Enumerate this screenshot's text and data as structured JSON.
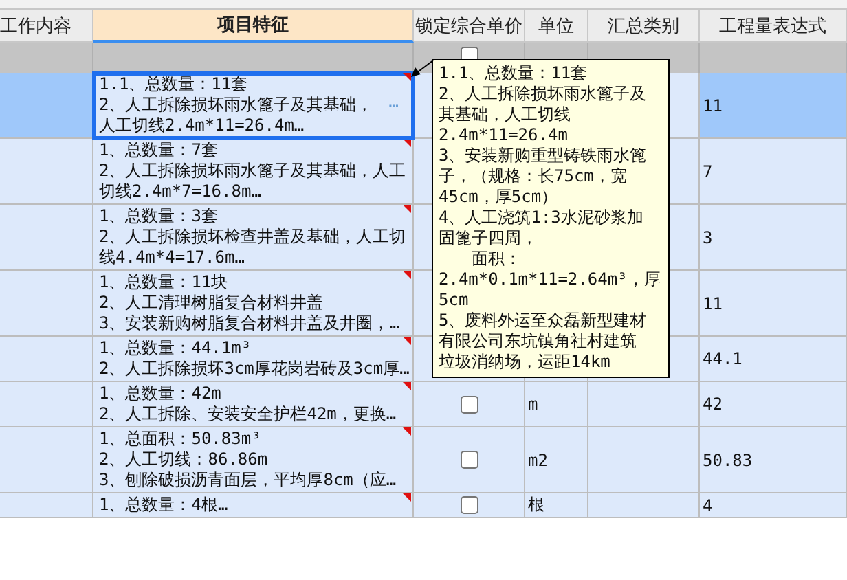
{
  "columns": [
    {
      "label": "工作内容",
      "kind": "plain"
    },
    {
      "label": "项目特征",
      "kind": "active"
    },
    {
      "label": "锁定综合单价",
      "kind": "plain"
    },
    {
      "label": "单位",
      "kind": "plain"
    },
    {
      "label": "汇总类别",
      "kind": "plain"
    },
    {
      "label": "工程量表达式",
      "kind": "plain"
    }
  ],
  "filter_row": {
    "locked": false
  },
  "rows": [
    {
      "selected": true,
      "features": [
        "1.1、总数量：11套",
        "2、人工拆除损坏雨水篦子及其基础，",
        "人工切线2.4m*11=26.4m…"
      ],
      "expression": "11",
      "ellipsis": "…"
    },
    {
      "selected": false,
      "features": [
        "1、总数量：7套",
        "2、人工拆除损坏雨水篦子及其基础，人工",
        "切线2.4m*7=16.8m…"
      ],
      "expression": "7"
    },
    {
      "selected": false,
      "features": [
        "1、总数量：3套",
        "2、人工拆除损坏检查井盖及基础，人工切",
        "线4.4m*4=17.6m…"
      ],
      "expression": "3"
    },
    {
      "selected": false,
      "features": [
        "1、总数量：11块",
        "2、人工清理树脂复合材料井盖",
        "3、安装新购树脂复合材料井盖及井圈，…"
      ],
      "expression": "11"
    },
    {
      "selected": false,
      "features": [
        "1、总数量：44.1m³",
        "2、人工拆除损坏3cm厚花岗岩砖及3cm厚…"
      ],
      "expression": "44.1"
    },
    {
      "selected": false,
      "features": [
        "1、总数量：42m",
        "2、人工拆除、安装安全护栏42m，更换…"
      ],
      "unit": "m",
      "expression": "42",
      "locked": false
    },
    {
      "selected": false,
      "features": [
        "1、总面积：50.83m³",
        "2、人工切线：86.86m",
        "3、刨除破损沥青面层，平均厚8cm（应…"
      ],
      "unit": "m2",
      "expression": "50.83",
      "locked": false
    },
    {
      "selected": false,
      "features": [
        "1、总数量：4根…"
      ],
      "unit": "根",
      "expression": "4",
      "locked": false
    }
  ],
  "tooltip": {
    "lines": [
      {
        "text": "1.1、总数量：11套",
        "indented": false
      },
      {
        "text": "2、人工拆除损坏雨水篦子及",
        "indented": false
      },
      {
        "text": "其基础，人工切线",
        "indented": false
      },
      {
        "text": "2.4m*11=26.4m",
        "indented": false
      },
      {
        "text": "3、安装新购重型铸铁雨水篦",
        "indented": false
      },
      {
        "text": "子，（规格：长75cm，宽",
        "indented": false
      },
      {
        "text": "45cm，厚5cm）",
        "indented": false
      },
      {
        "text": "4、人工浇筑1:3水泥砂浆加",
        "indented": false
      },
      {
        "text": "固篦子四周，",
        "indented": false
      },
      {
        "text": "面积：",
        "indented": true
      },
      {
        "text": "2.4m*0.1m*11=2.64m³，厚",
        "indented": false
      },
      {
        "text": "5cm",
        "indented": false
      },
      {
        "text": "5、废料外运至众磊新型建材",
        "indented": false
      },
      {
        "text": "有限公司东坑镇角社村建筑",
        "indented": false
      },
      {
        "text": "垃圾消纳场，运距14km",
        "indented": false
      }
    ]
  }
}
